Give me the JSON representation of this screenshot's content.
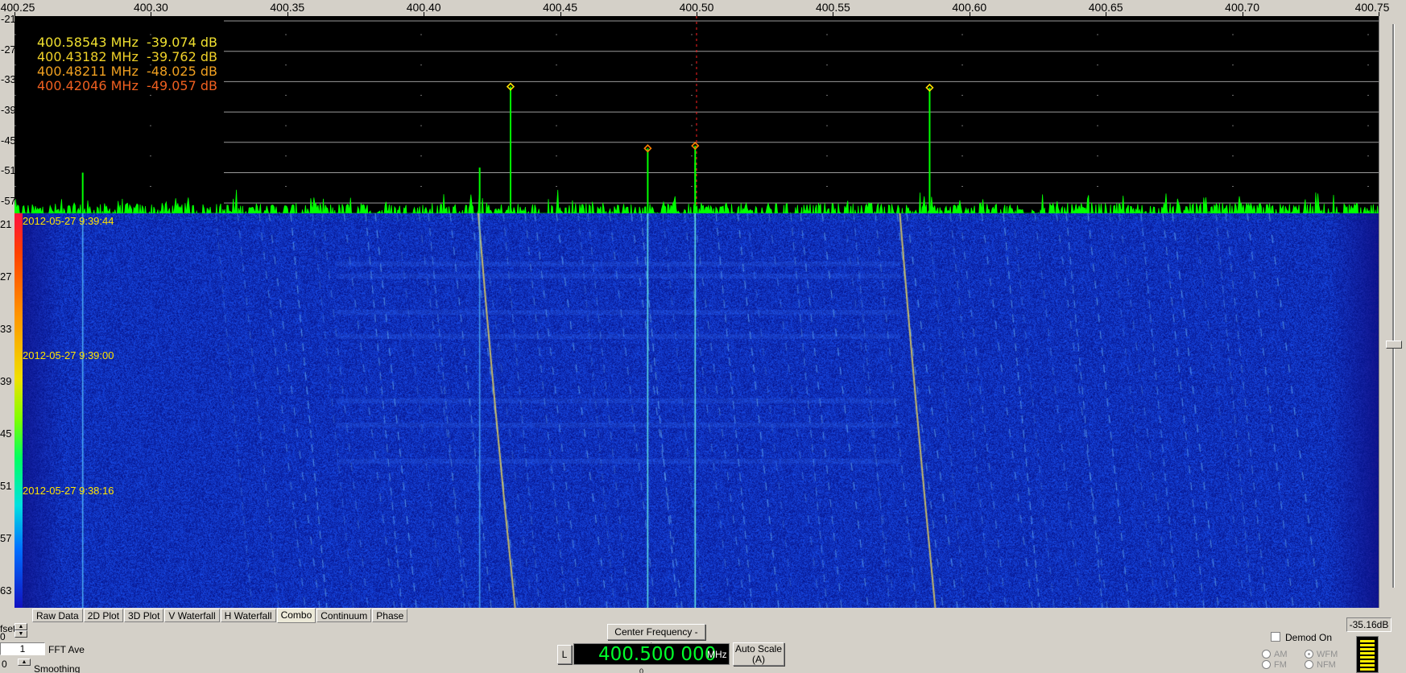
{
  "freq_axis": {
    "ticks": [
      "400.25",
      "400.30",
      "400.35",
      "400.40",
      "400.45",
      "400.50",
      "400.55",
      "400.60",
      "400.65",
      "400.70",
      "400.75"
    ],
    "min": 400.25,
    "max": 400.75
  },
  "db_axis": {
    "labels": [
      "-21",
      "-27",
      "-33",
      "-39",
      "-45",
      "-51",
      "-57"
    ],
    "min": -21,
    "max": -60
  },
  "waterfall_axis": {
    "labels": [
      "21",
      "27",
      "33",
      "39",
      "45",
      "51",
      "57",
      "63"
    ]
  },
  "markers": [
    {
      "text": "400.58543 MHz  -39.074 dB",
      "color": "#f0e030"
    },
    {
      "text": "400.43182 MHz  -39.762 dB",
      "color": "#f0d028"
    },
    {
      "text": "400.48211 MHz  -48.025 dB",
      "color": "#f0a020"
    },
    {
      "text": "400.42046 MHz  -49.057 dB",
      "color": "#f06020"
    }
  ],
  "peaks": [
    {
      "freq": 400.43182,
      "db": -34.0,
      "color": "#ffe000"
    },
    {
      "freq": 400.58543,
      "db": -34.2,
      "color": "#ffe000"
    },
    {
      "freq": 400.48211,
      "db": -46.2,
      "color": "#ff8000"
    },
    {
      "freq": 400.4995,
      "db": -45.7,
      "color": "#ff8000"
    }
  ],
  "spurs": [
    {
      "freq": 400.275,
      "db": -51.0
    },
    {
      "freq": 400.4205,
      "db": -50.0
    },
    {
      "freq": 400.4995,
      "db": -49.0
    }
  ],
  "waterfall": {
    "timestamps": [
      "2012-05-27 9:39:44",
      "2012-05-27 9:39:00",
      "2012-05-27 9:38:16"
    ]
  },
  "tabs": [
    "Raw Data",
    "2D Plot",
    "3D Plot",
    "V Waterfall",
    "H Waterfall",
    "Combo",
    "Continuum",
    "Phase"
  ],
  "active_tab": "Combo",
  "controls": {
    "offset_label": "fset",
    "offset_value": "0",
    "fft_ave_value": "1",
    "fft_ave_label": "FFT Ave",
    "smoothing_value": "0",
    "smoothing_label": "Smoothing",
    "center_freq_button": "Center Frequency - Ins",
    "l_button": "L",
    "frequency": "400.500 000",
    "frequency_unit": "MHz",
    "auto_scale_line1": "Auto Scale",
    "auto_scale_line2": "(A)",
    "below_freq": "0",
    "demod_label": "Demod On",
    "radio_am": "AM",
    "radio_wfm": "WFM",
    "radio_fm": "FM",
    "radio_nfm": "NFM",
    "level_readout": "-35.16dB"
  },
  "colors": {
    "spectrum_trace": "#00ff00",
    "waterfall_bg": "#0c1fa8",
    "center_line": "#ff2020"
  }
}
